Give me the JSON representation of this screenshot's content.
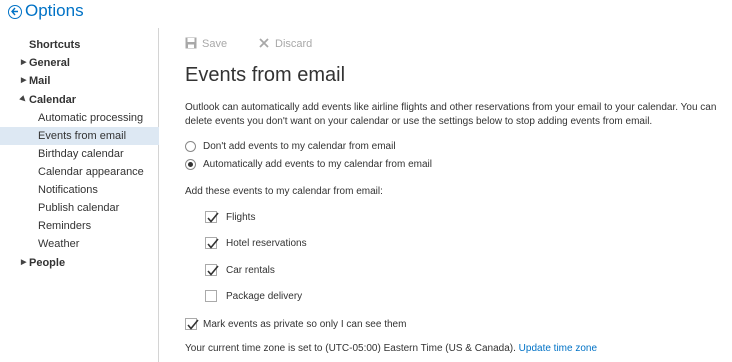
{
  "app": {
    "title": "Options"
  },
  "sidebar": {
    "items": [
      {
        "label": "Shortcuts"
      },
      {
        "label": "General"
      },
      {
        "label": "Mail"
      },
      {
        "label": "Calendar"
      },
      {
        "label": "Automatic processing"
      },
      {
        "label": "Events from email"
      },
      {
        "label": "Birthday calendar"
      },
      {
        "label": "Calendar appearance"
      },
      {
        "label": "Notifications"
      },
      {
        "label": "Publish calendar"
      },
      {
        "label": "Reminders"
      },
      {
        "label": "Weather"
      },
      {
        "label": "People"
      }
    ]
  },
  "toolbar": {
    "save_label": "Save",
    "discard_label": "Discard"
  },
  "main": {
    "title": "Events from email",
    "description": "Outlook can automatically add events like airline flights and other reservations from your email to your calendar. You can delete events you don't want on your calendar or use the settings below to stop adding events from email.",
    "radio_options": [
      {
        "label": "Don't add events to my calendar from email",
        "selected": false
      },
      {
        "label": "Automatically add events to my calendar from email",
        "selected": true
      }
    ],
    "events_label": "Add these events to my calendar from email:",
    "event_types": [
      {
        "label": "Flights",
        "checked": true
      },
      {
        "label": "Hotel reservations",
        "checked": true
      },
      {
        "label": "Car rentals",
        "checked": true
      },
      {
        "label": "Package delivery",
        "checked": false
      }
    ],
    "private_label": "Mark events as private so only I can see them",
    "private_checked": true,
    "timezone_text": "Your current time zone is set to (UTC-05:00) Eastern Time (US & Canada).",
    "timezone_link": "Update time zone"
  },
  "colors": {
    "accent": "#0072c6",
    "selected_bg": "#dde8f3",
    "disabled": "#a8a8a8"
  }
}
